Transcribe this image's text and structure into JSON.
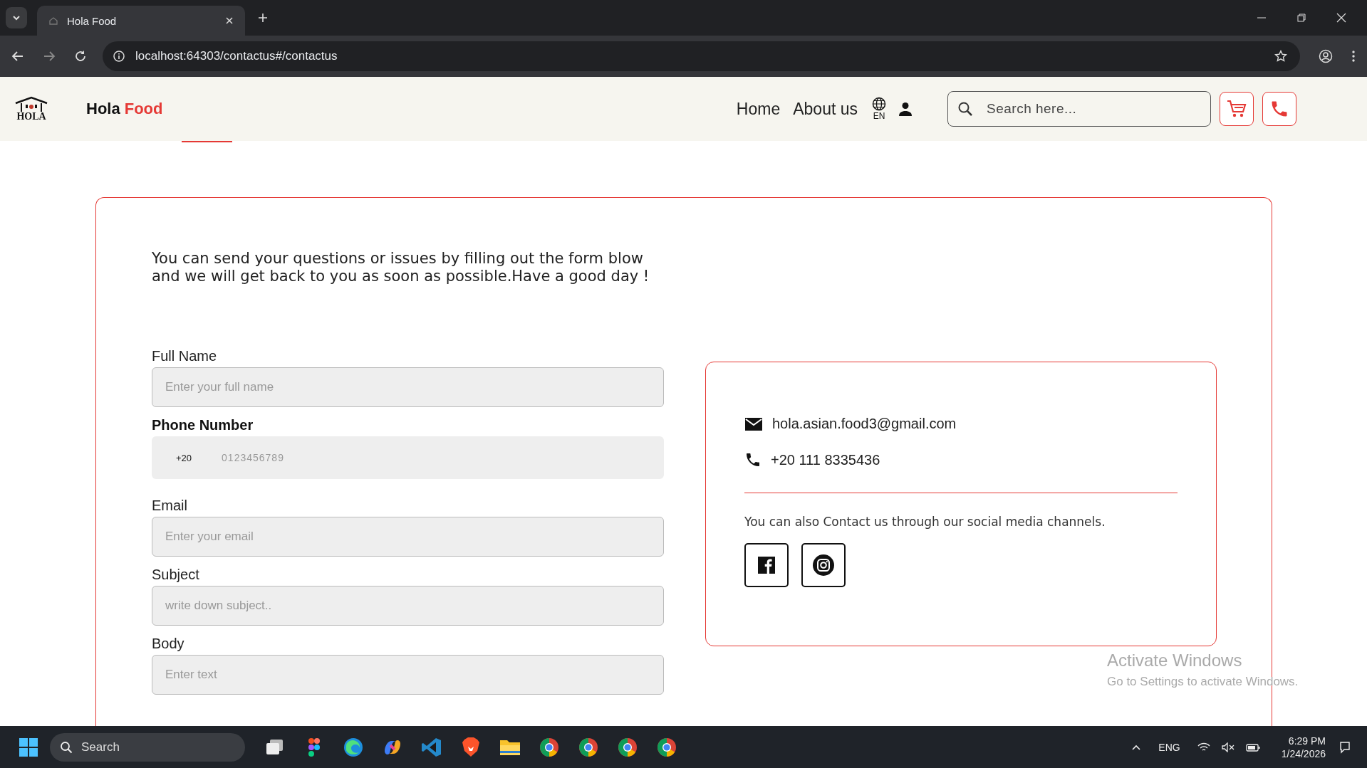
{
  "browser": {
    "tab_title": "Hola Food",
    "url": "localhost:64303/contactus#/contactus"
  },
  "header": {
    "logo_text": "HOLA",
    "brand_name": "Hola",
    "brand_accent": "Food",
    "nav": [
      {
        "label": "Home"
      },
      {
        "label": "About us"
      }
    ],
    "language": "EN",
    "search": {
      "placeholder": "Search here..."
    }
  },
  "intro": "You can send your questions or issues by filling out the form blow and we will get back to you as soon as possible.Have a good day !",
  "form": {
    "fields": [
      {
        "kind": "text",
        "label": "Full Name",
        "placeholder": "Enter your full name"
      },
      {
        "kind": "phone",
        "label": "Phone Number",
        "prefix": "+20",
        "placeholder": "0123456789"
      },
      {
        "kind": "text",
        "label": "Email",
        "placeholder": "Enter your email"
      },
      {
        "kind": "text",
        "label": "Subject",
        "placeholder": "write down subject.."
      },
      {
        "kind": "text",
        "label": "Body",
        "placeholder": "Enter text"
      }
    ]
  },
  "contact": {
    "items": [
      {
        "kind": "email",
        "text": "hola.asian.food3@gmail.com"
      },
      {
        "kind": "phone",
        "text": "+20 111 8335436"
      }
    ],
    "social_text": "You can also Contact us through our social media channels.",
    "socials": [
      {
        "kind": "facebook"
      },
      {
        "kind": "instagram"
      }
    ]
  },
  "activation": {
    "title": "Activate Windows",
    "subtitle": "Go to Settings to activate Windows."
  },
  "taskbar": {
    "search": {
      "placeholder": "Search"
    },
    "apps": [
      {
        "kind": "taskview"
      },
      {
        "kind": "figma"
      },
      {
        "kind": "edge"
      },
      {
        "kind": "copilot"
      },
      {
        "kind": "vscode"
      },
      {
        "kind": "brave"
      },
      {
        "kind": "files"
      },
      {
        "kind": "chrome"
      },
      {
        "kind": "chrome"
      },
      {
        "kind": "chrome"
      },
      {
        "kind": "chrome"
      }
    ],
    "language": "ENG",
    "time": "6:29 PM",
    "date": "1/24/2026"
  }
}
